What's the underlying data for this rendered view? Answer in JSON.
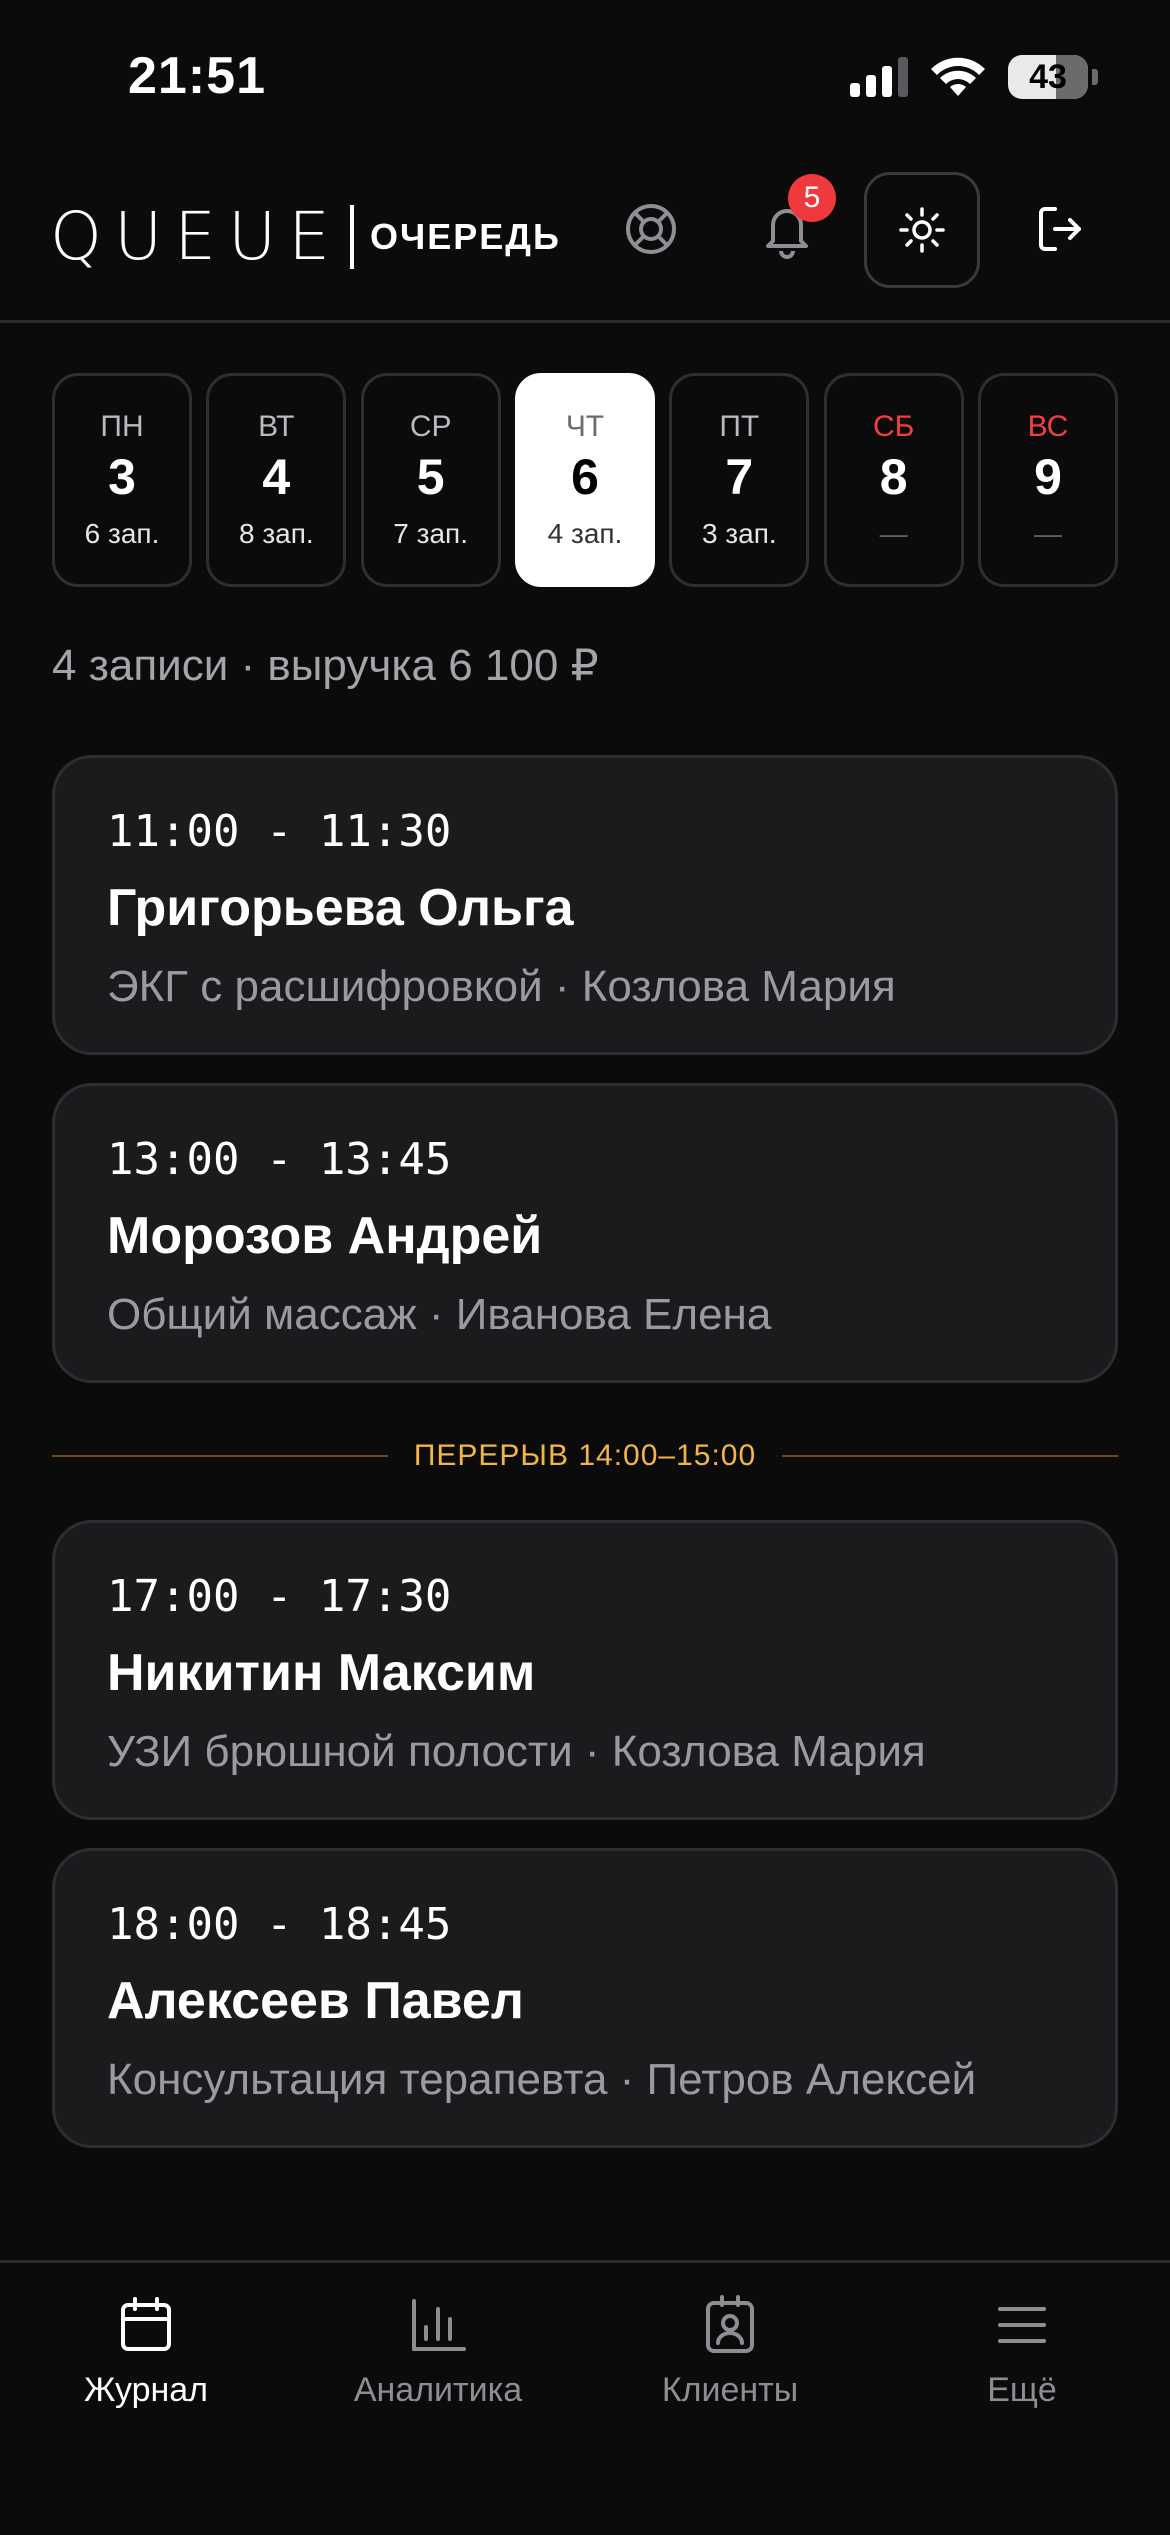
{
  "status_bar": {
    "time": "21:51",
    "battery": "43"
  },
  "header": {
    "logo": "QUEUE",
    "logo_sub": "ОЧЕРЕДЬ",
    "notifications_count": "5"
  },
  "days": [
    {
      "name": "ПН",
      "num": "3",
      "count": "6 зап.",
      "weekend": false,
      "active": false
    },
    {
      "name": "ВТ",
      "num": "4",
      "count": "8 зап.",
      "weekend": false,
      "active": false
    },
    {
      "name": "СР",
      "num": "5",
      "count": "7 зап.",
      "weekend": false,
      "active": false
    },
    {
      "name": "ЧТ",
      "num": "6",
      "count": "4 зап.",
      "weekend": false,
      "active": true
    },
    {
      "name": "ПТ",
      "num": "7",
      "count": "3 зап.",
      "weekend": false,
      "active": false
    },
    {
      "name": "СБ",
      "num": "8",
      "count": "—",
      "weekend": true,
      "active": false
    },
    {
      "name": "ВС",
      "num": "9",
      "count": "—",
      "weekend": true,
      "active": false
    }
  ],
  "summary": "4 записи · выручка 6 100 ₽",
  "appointments": [
    {
      "time": "11:00 - 11:30",
      "client": "Григорьева Ольга",
      "details": "ЭКГ с расшифровкой · Козлова Мария"
    },
    {
      "time": "13:00 - 13:45",
      "client": "Морозов Андрей",
      "details": "Общий массаж · Иванова Елена"
    },
    {
      "time": "17:00 - 17:30",
      "client": "Никитин Максим",
      "details": "УЗИ брюшной полости · Козлова Мария"
    },
    {
      "time": "18:00 - 18:45",
      "client": "Алексеев Павел",
      "details": "Консультация терапевта · Петров Алексей"
    }
  ],
  "break_label": "ПЕРЕРЫВ 14:00–15:00",
  "nav": [
    {
      "label": "Журнал",
      "icon": "calendar-icon",
      "active": true
    },
    {
      "label": "Аналитика",
      "icon": "chart-icon",
      "active": false
    },
    {
      "label": "Клиенты",
      "icon": "contact-icon",
      "active": false
    },
    {
      "label": "Ещё",
      "icon": "menu-icon",
      "active": false
    }
  ],
  "colors": {
    "accent_break": "#f3b544",
    "weekend": "#ef4040",
    "badge": "#f0393d"
  }
}
